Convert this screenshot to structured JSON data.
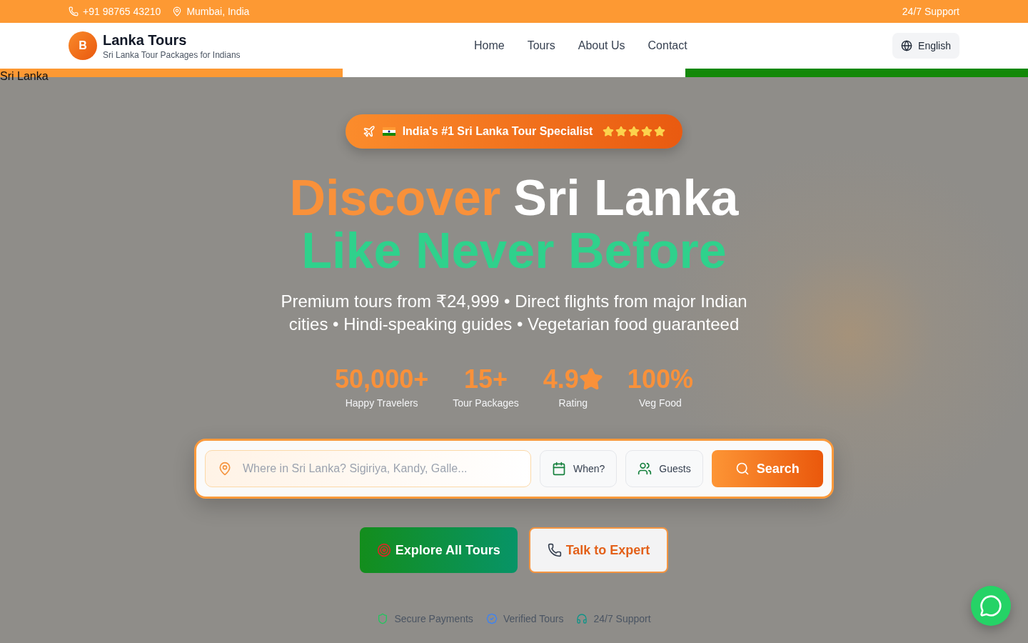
{
  "top_bar": {
    "phone": "+91 98765 43210",
    "location": "Mumbai, India",
    "support": "24/7 Support"
  },
  "header": {
    "logo_letter": "B",
    "brand": "Lanka Tours",
    "tagline": "Sri Lanka Tour Packages for Indians",
    "nav": [
      {
        "label": "Home"
      },
      {
        "label": "Tours"
      },
      {
        "label": "About Us"
      },
      {
        "label": "Contact"
      }
    ],
    "language": "English"
  },
  "hero": {
    "broken_image_alt": "Sri Lanka",
    "badge": {
      "text": "India's #1 Sri Lanka Tour Specialist",
      "stars": 5
    },
    "title": {
      "line1_accent": "Discover",
      "line1_rest": "Sri Lanka",
      "line2": "Like Never Before"
    },
    "subtitle": "Premium tours from ₹24,999 • Direct flights from major Indian cities • Hindi-speaking guides • Vegetarian food guaranteed",
    "stats": [
      {
        "kind": "plain",
        "value": "50,000+",
        "label": "Happy Travelers"
      },
      {
        "kind": "plain",
        "value": "15+",
        "label": "Tour Packages"
      },
      {
        "kind": "rating",
        "value": "4.9",
        "label": "Rating"
      },
      {
        "kind": "plain",
        "value": "100%",
        "label": "Veg Food"
      }
    ],
    "search": {
      "placeholder": "Where in Sri Lanka? Sigiriya, Kandy, Galle...",
      "date": "When?",
      "guests": "Guests",
      "button": "Search"
    },
    "actions": {
      "primary": "Explore All Tours",
      "secondary": "Talk to Expert"
    },
    "trust": [
      {
        "kind": "shield",
        "label": "Secure Payments"
      },
      {
        "kind": "check",
        "label": "Verified Tours"
      },
      {
        "kind": "headset",
        "label": "24/7 Support"
      }
    ]
  }
}
